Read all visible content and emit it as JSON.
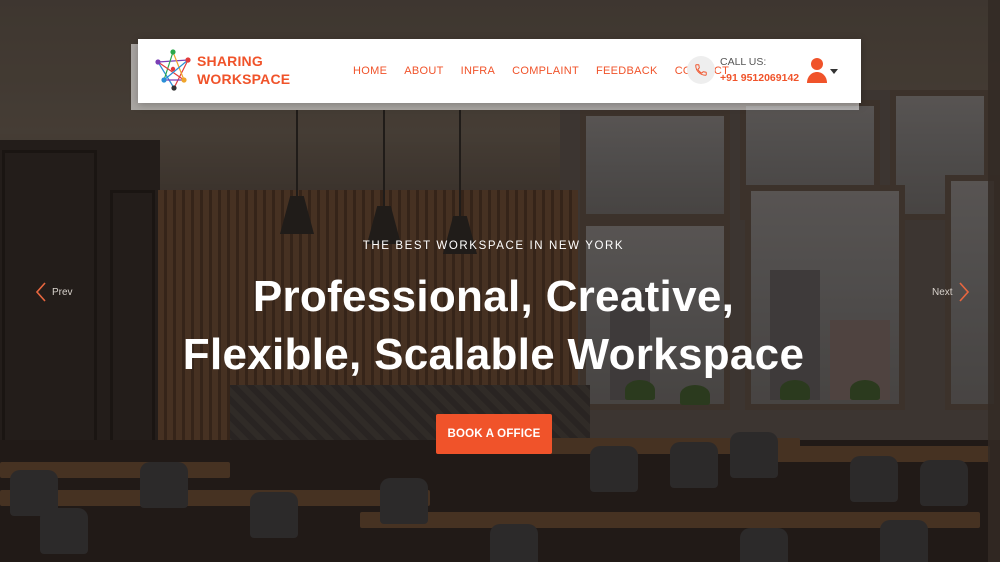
{
  "brand": {
    "line1": "SHARING",
    "line2": "WORKSPACE",
    "accent_color": "#f0532a"
  },
  "nav": {
    "items": [
      {
        "label": "HOME"
      },
      {
        "label": "ABOUT"
      },
      {
        "label": "INFRA"
      },
      {
        "label": "COMPLAINT"
      },
      {
        "label": "FEEDBACK"
      },
      {
        "label": "CONTACT"
      }
    ]
  },
  "contact": {
    "label": "CALL US:",
    "number": "+91 9512069142",
    "icon": "phone-icon"
  },
  "account": {
    "icon": "user-icon",
    "dropdown_icon": "caret-down-icon"
  },
  "hero": {
    "kicker": "THE BEST WORKSPACE IN NEW YORK",
    "headline_line1": "Professional, Creative,",
    "headline_line2": "Flexible, Scalable Workspace",
    "cta_label": "BOOK A OFFICE"
  },
  "carousel": {
    "prev_label": "Prev",
    "next_label": "Next"
  }
}
